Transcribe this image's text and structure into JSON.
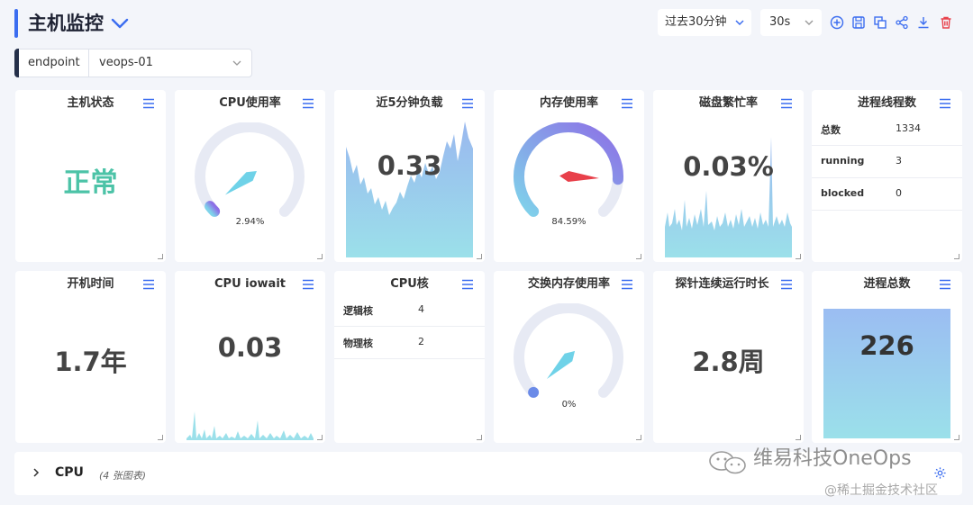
{
  "header": {
    "title": "主机监控",
    "time_range": "过去30分钟",
    "refresh": "30s"
  },
  "filter": {
    "label": "endpoint",
    "value": "veops-01"
  },
  "panels": {
    "host_status": {
      "title": "主机状态",
      "value": "正常"
    },
    "cpu_usage": {
      "title": "CPU使用率",
      "value": "2.94%",
      "percent": 2.94
    },
    "load5": {
      "title": "近5分钟负载",
      "value": "0.33"
    },
    "mem_usage": {
      "title": "内存使用率",
      "value": "84.59%",
      "percent": 84.59
    },
    "disk_busy": {
      "title": "磁盘繁忙率",
      "value": "0.03%"
    },
    "proc_threads": {
      "title": "进程线程数",
      "rows": [
        {
          "key": "总数",
          "value": "1334"
        },
        {
          "key": "running",
          "value": "3"
        },
        {
          "key": "blocked",
          "value": "0"
        }
      ]
    },
    "uptime": {
      "title": "开机时间",
      "value": "1.7年"
    },
    "cpu_iowait": {
      "title": "CPU iowait",
      "value": "0.03"
    },
    "cpu_cores": {
      "title": "CPU核",
      "rows": [
        {
          "key": "逻辑核",
          "value": "4"
        },
        {
          "key": "物理核",
          "value": "2"
        }
      ]
    },
    "swap_usage": {
      "title": "交换内存使用率",
      "value": "0%",
      "percent": 0
    },
    "probe_uptime": {
      "title": "探针连续运行时长",
      "value": "2.8周"
    },
    "proc_total": {
      "title": "进程总数",
      "value": "226"
    }
  },
  "cpu_section": {
    "title": "CPU",
    "count": "(4 张图表)"
  },
  "watermark": {
    "line1": "维易科技OneOps",
    "line2": "@稀土掘金技术社区"
  },
  "colors": {
    "accent": "#3b6df0",
    "status_ok": "#4cc3a7",
    "danger": "#e8404a"
  }
}
